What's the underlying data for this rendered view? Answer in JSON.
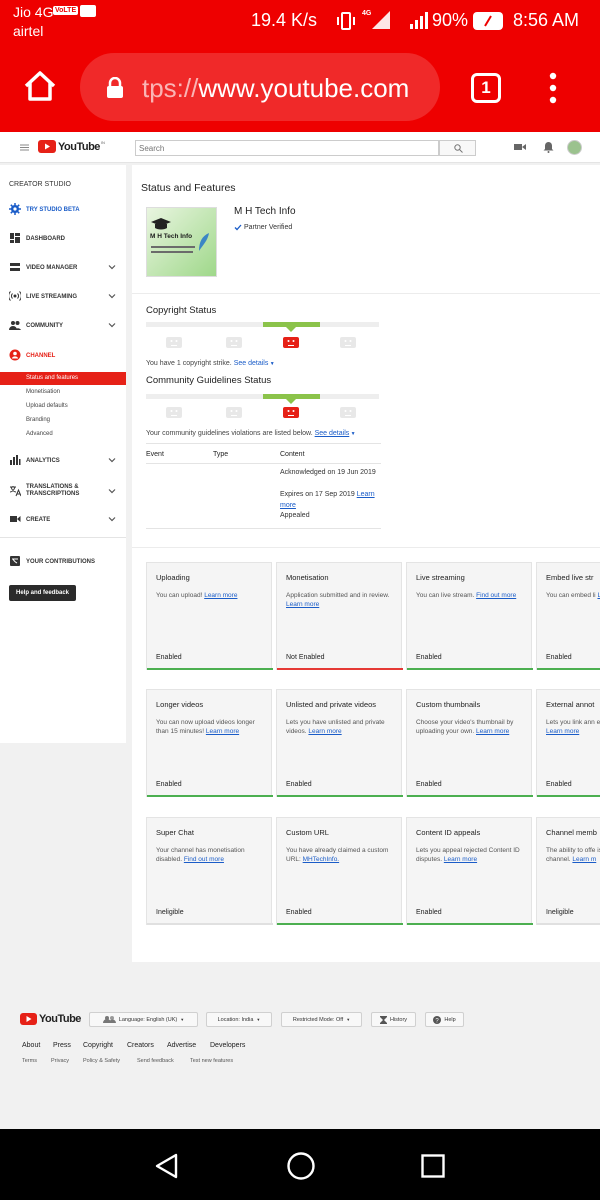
{
  "status_bar": {
    "carrier1": "Jio 4G",
    "volte": "VoLTE",
    "carrier2": "airtel",
    "speed": "19.4 K/s",
    "battery": "90%",
    "time": "8:56 AM",
    "net": "4G"
  },
  "browser": {
    "url_prefix": "tps://",
    "url_main": "www.youtube.com",
    "tab_count": "1"
  },
  "yt": {
    "logo": "YouTube",
    "region": "IN",
    "search_placeholder": "Search"
  },
  "sidebar": {
    "header": "CREATOR STUDIO",
    "items": [
      {
        "label": "TRY STUDIO BETA"
      },
      {
        "label": "DASHBOARD"
      },
      {
        "label": "VIDEO MANAGER"
      },
      {
        "label": "LIVE STREAMING"
      },
      {
        "label": "COMMUNITY"
      },
      {
        "label": "CHANNEL"
      }
    ],
    "sub": [
      "Status and features",
      "Monetisation",
      "Upload defaults",
      "Branding",
      "Advanced"
    ],
    "items2": [
      {
        "label": "ANALYTICS"
      },
      {
        "label": "TRANSLATIONS & TRANSCRIPTIONS"
      },
      {
        "label": "CREATE"
      },
      {
        "label": "YOUR CONTRIBUTIONS"
      }
    ],
    "help_button": "Help and feedback"
  },
  "main": {
    "title": "Status and Features",
    "channel_name": "M H Tech Info",
    "verified": "Partner Verified",
    "thumb_title": "M H Tech Info",
    "copyright_title": "Copyright Status",
    "copyright_text": "You have 1 copyright strike.",
    "see_details": "See details",
    "community_title": "Community Guidelines Status",
    "community_text": "Your community guidelines violations are listed below.",
    "table": {
      "headers": [
        "Event",
        "Type",
        "Content"
      ],
      "acknowledged": "Acknowledged on 19 Jun 2019",
      "expires": "Expires on 17 Sep 2019",
      "learn_more": "Learn more",
      "appealed": "Appealed"
    },
    "cards": [
      {
        "title": "Uploading",
        "desc": "You can upload!",
        "link": "Learn more",
        "status": "Enabled",
        "color": "#4caf50"
      },
      {
        "title": "Monetisation",
        "desc": "Application submitted and in review.",
        "link": "Learn more",
        "status": "Not Enabled",
        "color": "#e53935"
      },
      {
        "title": "Live streaming",
        "desc": "You can live stream.",
        "link": "Find out more",
        "status": "Enabled",
        "color": "#4caf50"
      },
      {
        "title": "Embed live str",
        "desc": "You can embed li",
        "link": "Learn more",
        "status": "Enabled",
        "color": "#4caf50"
      },
      {
        "title": "Longer videos",
        "desc": "You can now upload videos longer than 15 minutes!",
        "link": "Learn more",
        "status": "Enabled",
        "color": "#4caf50"
      },
      {
        "title": "Unlisted and private videos",
        "desc": "Lets you have unlisted and private videos.",
        "link": "Learn more",
        "status": "Enabled",
        "color": "#4caf50"
      },
      {
        "title": "Custom thumbnails",
        "desc": "Choose your video's thumbnail by uploading your own.",
        "link": "Learn more",
        "status": "Enabled",
        "color": "#4caf50"
      },
      {
        "title": "External annot",
        "desc": "Lets you link ann external sites or n",
        "link": "Learn more",
        "status": "Enabled",
        "color": "#4caf50"
      },
      {
        "title": "Super Chat",
        "desc": "Your channel has monetisation disabled.",
        "link": "Find out more",
        "status": "Ineligible",
        "color": "#e0e0e0"
      },
      {
        "title": "Custom URL",
        "desc": "You have already claimed a custom URL:",
        "link": "MHTechInfo.",
        "status": "Enabled",
        "color": "#4caf50"
      },
      {
        "title": "Content ID appeals",
        "desc": "Lets you appeal rejected Content ID disputes.",
        "link": "Learn more",
        "status": "Enabled",
        "color": "#4caf50"
      },
      {
        "title": "Channel memb",
        "desc": "The ability to offe isn't yet available channel.",
        "link": "Learn m",
        "status": "Ineligible",
        "color": "#e0e0e0"
      }
    ]
  },
  "footer": {
    "logo": "YouTube",
    "language": "Language: English (UK)",
    "location": "Location: India",
    "restricted": "Restricted Mode: Off",
    "history": "History",
    "help": "Help",
    "links": [
      "About",
      "Press",
      "Copyright",
      "Creators",
      "Advertise",
      "Developers"
    ],
    "sublinks": [
      "Terms",
      "Privacy",
      "Policy & Safety",
      "Send feedback",
      "Test new features"
    ]
  },
  "colors": {
    "accent_red": "#ee0000",
    "yt_red": "#e62117",
    "green": "#8bc34a",
    "link_blue": "#1a5cc8"
  }
}
